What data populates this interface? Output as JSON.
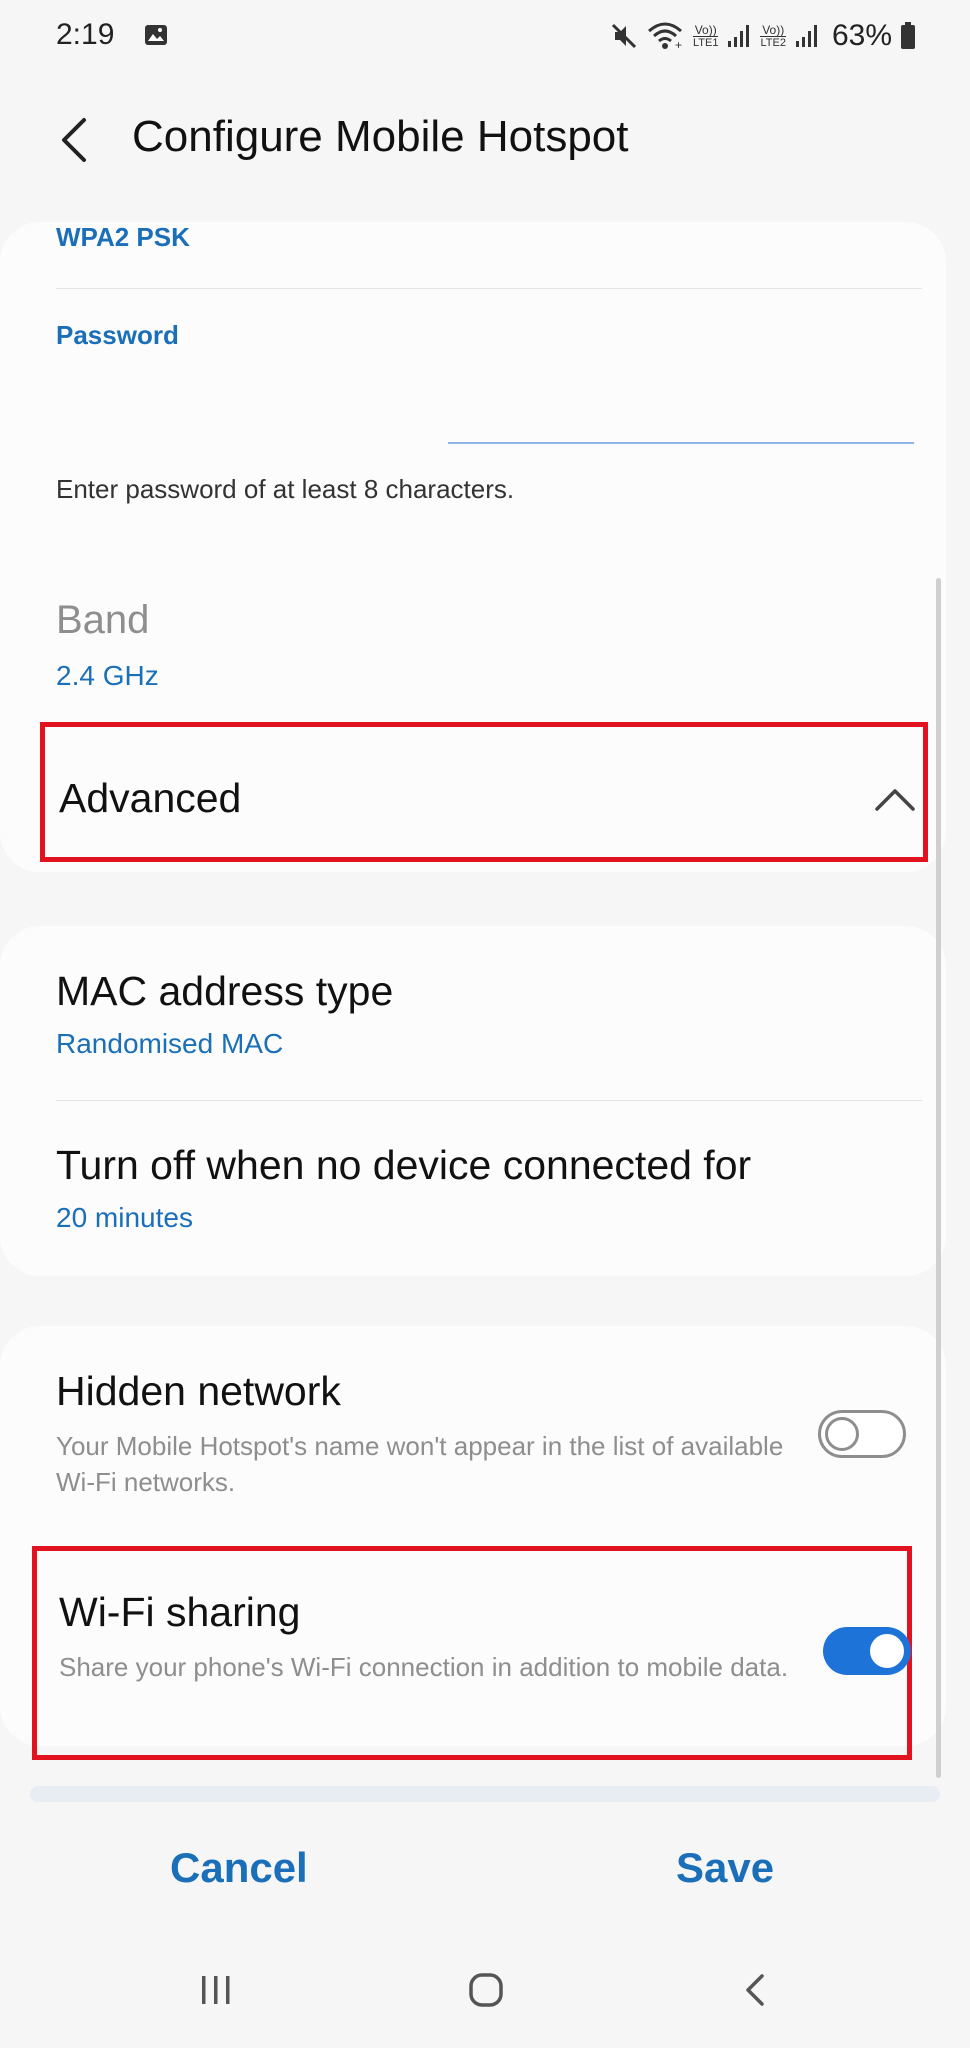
{
  "status_bar": {
    "time": "2:19",
    "battery_percent": "63%",
    "sim1_label": "LTE1",
    "sim2_label": "LTE2",
    "volte_label": "Vo))"
  },
  "header": {
    "title": "Configure Mobile Hotspot"
  },
  "security_card": {
    "security_value": "WPA2 PSK",
    "password_label": "Password",
    "password_value": "",
    "password_hint": "Enter password of at least 8 characters.",
    "band_label": "Band",
    "band_value": "2.4 GHz",
    "advanced_label": "Advanced"
  },
  "advanced_card": {
    "mac_title": "MAC address type",
    "mac_value": "Randomised MAC",
    "timeout_title": "Turn off when no device connected for",
    "timeout_value": "20 minutes"
  },
  "toggles_card": {
    "hidden_title": "Hidden network",
    "hidden_desc": "Your Mobile Hotspot's name won't appear in the list of available Wi-Fi networks.",
    "hidden_on": false,
    "wifi_sharing_title": "Wi-Fi sharing",
    "wifi_sharing_desc": "Share your phone's Wi-Fi connection in addition to mobile data.",
    "wifi_sharing_on": true
  },
  "footer": {
    "cancel_label": "Cancel",
    "save_label": "Save"
  },
  "colors": {
    "accent": "#1a6fb8",
    "toggle_on": "#1e73d9",
    "highlight": "#e0131e"
  }
}
